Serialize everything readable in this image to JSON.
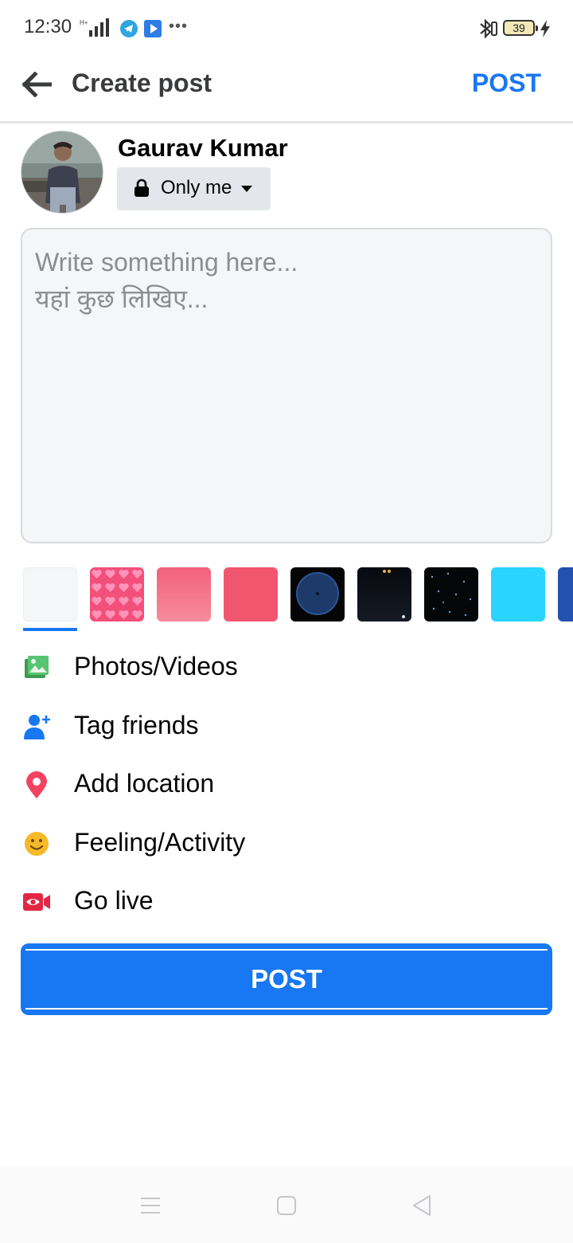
{
  "status_bar": {
    "time": "12:30",
    "battery_level": "39",
    "icons": [
      "signal-icon",
      "telegram-icon",
      "play-icon",
      "more-icon",
      "bluetooth-icon",
      "battery-icon",
      "charging-icon"
    ]
  },
  "header": {
    "title": "Create post",
    "post_label": "POST",
    "back_icon": "arrow-left-icon"
  },
  "user": {
    "name": "Gaurav Kumar",
    "audience_label": "Only me"
  },
  "compose": {
    "placeholder": "Write something here...\nयहां कुछ लिखिए..."
  },
  "backgrounds": {
    "selected_index": 0,
    "swatches": [
      "plain-white",
      "pink-hearts",
      "pink-gradient",
      "coral-red",
      "dark-planet",
      "dark-night",
      "starry-night",
      "cyan",
      "blue"
    ]
  },
  "options": [
    {
      "label": "Photos/Videos",
      "icon": "photo-icon"
    },
    {
      "label": "Tag friends",
      "icon": "tag-friends-icon"
    },
    {
      "label": "Add location",
      "icon": "location-pin-icon"
    },
    {
      "label": "Feeling/Activity",
      "icon": "smiley-icon"
    },
    {
      "label": "Go live",
      "icon": "live-video-icon"
    }
  ],
  "post_button": {
    "label": "POST"
  },
  "colors": {
    "accent": "#1877f2",
    "photo_green": "#58c472",
    "tag_blue": "#1877f2",
    "location_red": "#f3425f",
    "feeling_yellow": "#f7b928",
    "live_red": "#e42645"
  }
}
